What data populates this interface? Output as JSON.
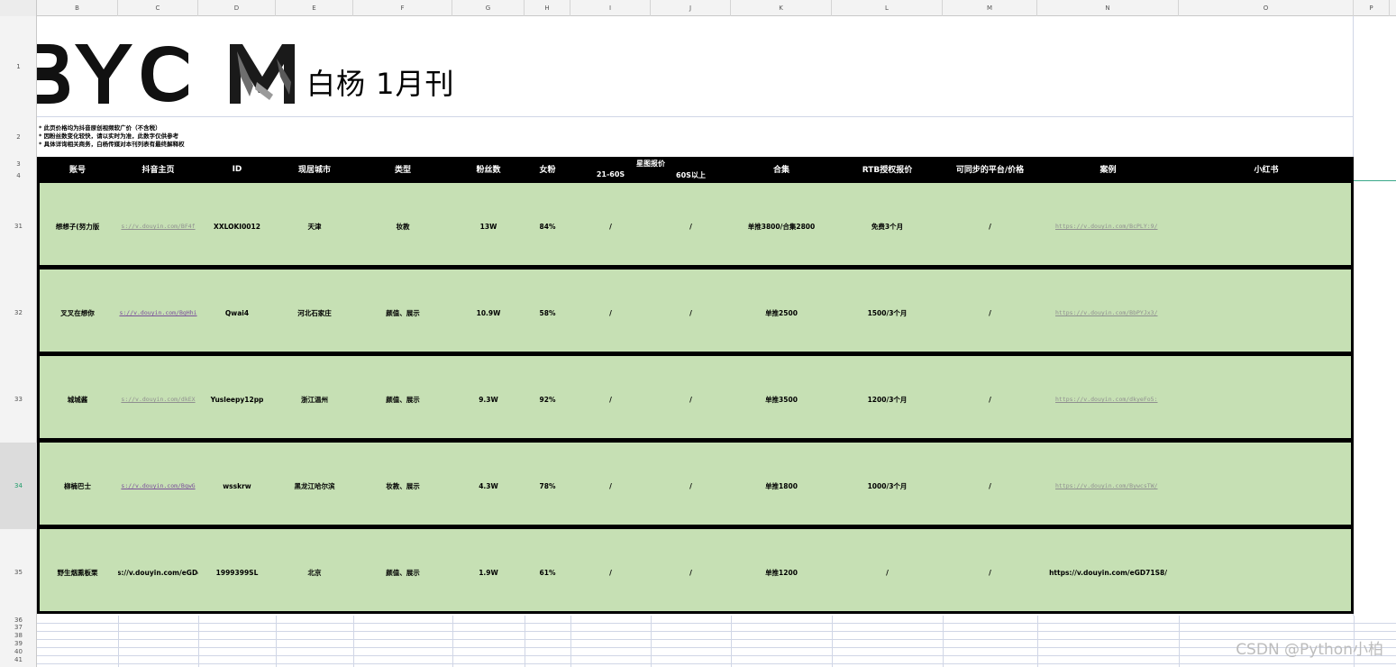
{
  "columns": [
    "B",
    "C",
    "D",
    "E",
    "F",
    "G",
    "H",
    "I",
    "J",
    "K",
    "L",
    "M",
    "N",
    "O",
    "P"
  ],
  "row_numbers": {
    "header_rows": [
      "1",
      "2",
      "3",
      "4"
    ],
    "data_rows": [
      "31",
      "32",
      "33",
      "34",
      "35"
    ],
    "empty_rows": [
      "36",
      "37",
      "38",
      "39",
      "40",
      "41"
    ]
  },
  "header": {
    "logo_text": "BYCM",
    "title": "白杨 1月刊"
  },
  "notes": [
    "* 此页价格均为抖音原创视频软广价（不含税）",
    "* 因粉丝数变化较快，请以实时为准，此数字仅供参考",
    "* 具体详询相关商务，白杨传媒对本刊列表有最终解释权"
  ],
  "table": {
    "headers": {
      "account": "账号",
      "douyin_home": "抖音主页",
      "id": "ID",
      "city": "现居城市",
      "type": "类型",
      "fans": "粉丝数",
      "female": "女粉",
      "star_quote": "星图报价",
      "q_21_60": "21-60S",
      "q_60_plus": "60S以上",
      "collection": "合集",
      "rtb": "RTB授权报价",
      "sync": "可同步的平台/价格",
      "case": "案例",
      "xhs": "小红书"
    },
    "rows": [
      {
        "account": "想想子(努力版",
        "home": "s://v.douyin.com/BF4f",
        "id": "XXLOKI0012",
        "city": "天津",
        "type": "妆教",
        "fans": "13W",
        "female": "84%",
        "q1": "/",
        "q2": "/",
        "collection": "单推3800/合集2800",
        "rtb": "免费3个月",
        "sync": "/",
        "case": "https://v.douyin.com/BcPLY:9/"
      },
      {
        "account": "叉叉在想你",
        "home": "s://v.douyin.com/BgHhi",
        "id": "Qwai4",
        "city": "河北石家庄",
        "type": "颜值、展示",
        "fans": "10.9W",
        "female": "58%",
        "q1": "/",
        "q2": "/",
        "collection": "单推2500",
        "rtb": "1500/3个月",
        "sync": "/",
        "case": "https://v.douyin.com/BbPYJx3/"
      },
      {
        "account": "城城酱",
        "home": "s://v.douyin.com/dkEX",
        "id": "Yusleepy12pp",
        "city": "浙江温州",
        "type": "颜值、展示",
        "fans": "9.3W",
        "female": "92%",
        "q1": "/",
        "q2": "/",
        "collection": "单推3500",
        "rtb": "1200/3个月",
        "sync": "/",
        "case": "https://v.douyin.com/dkyeFo5:"
      },
      {
        "account": "柳楠巴士",
        "home": "s://v.douyin.com/BqwG",
        "id": "wsskrw",
        "city": "黑龙江哈尔滨",
        "type": "妆教、展示",
        "fans": "4.3W",
        "female": "78%",
        "q1": "/",
        "q2": "/",
        "collection": "单推1800",
        "rtb": "1000/3个月",
        "sync": "/",
        "case": "https://v.douyin.com/BywcsTW/"
      },
      {
        "account": "野生烟熏板栗",
        "home": "os://v.douyin.com/eGDcl",
        "id": "1999399SL",
        "city": "北京",
        "type": "颜值、展示",
        "fans": "1.9W",
        "female": "61%",
        "q1": "/",
        "q2": "/",
        "collection": "单推1200",
        "rtb": "/",
        "sync": "/",
        "case": "https://v.douyin.com/eGD71S8/"
      }
    ]
  },
  "watermark": "CSDN @Python小柏"
}
